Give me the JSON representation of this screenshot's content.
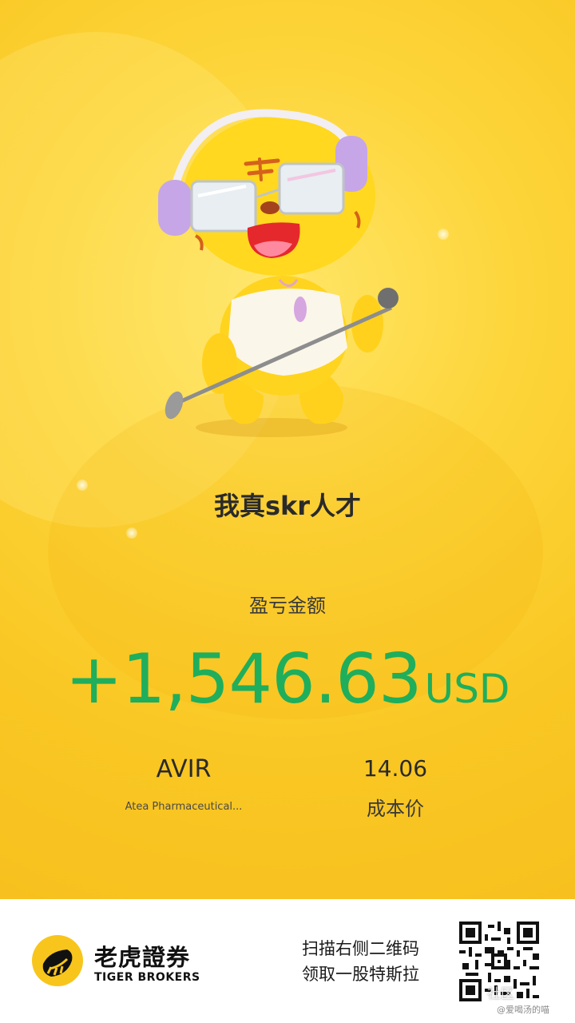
{
  "card": {
    "caption": "我真skr人才",
    "pnl_label": "盈亏金额",
    "pnl_amount": "+1,546.63",
    "pnl_currency": "USD",
    "ticker": "AVIR",
    "company_name": "Atea Pharmaceutical...",
    "cost_value": "14.06",
    "cost_label": "成本价"
  },
  "footer": {
    "brand_cn": "老虎證券",
    "brand_en": "TIGER BROKERS",
    "scan_line1": "扫描右侧二维码",
    "scan_line2": "领取一股特斯拉",
    "watermark_community": "社区",
    "watermark_user": "@爱喝汤的喵"
  },
  "colors": {
    "background": "#f9c723",
    "profit_green": "#1fae5c",
    "text_dark": "#2a2a2a"
  },
  "icons": {
    "mascot": "tiger-mascot-with-headphones-and-microphone",
    "logo": "tiger-brokers-logo-icon",
    "qr": "qr-code-icon"
  }
}
